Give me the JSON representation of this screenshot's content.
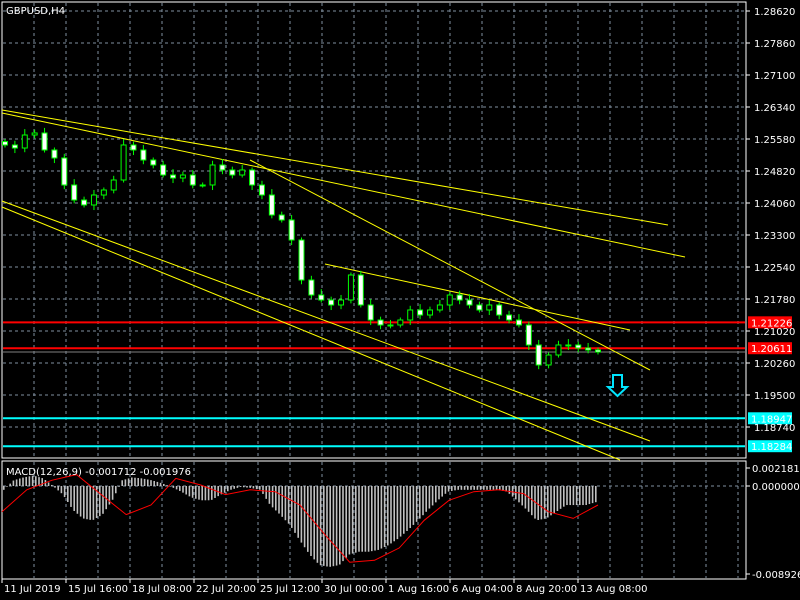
{
  "chart_data": [
    {
      "type": "candlestick",
      "title": "GBPUSD,H4",
      "grid": true,
      "ylim": [
        1.1771,
        1.29
      ],
      "y_ticks": [
        "1.28620",
        "1.27860",
        "1.27100",
        "1.26340",
        "1.25580",
        "1.24820",
        "1.24060",
        "1.23300",
        "1.22540",
        "1.21780",
        "1.21020",
        "1.20260",
        "1.19500",
        "1.18740"
      ],
      "x_ticks": [
        "11 Jul 2019",
        "15 Jul 16:00",
        "18 Jul 08:00",
        "22 Jul 20:00",
        "25 Jul 12:00",
        "30 Jul 00:00",
        "1 Aug 16:00",
        "6 Aug 04:00",
        "8 Aug 20:00",
        "13 Aug 08:00"
      ],
      "closes": [
        1.25438,
        1.25366,
        1.25675,
        1.25723,
        1.25319,
        1.25129,
        1.24488,
        1.24131,
        1.24013,
        1.2425,
        1.24369,
        1.24606,
        1.25438,
        1.25319,
        1.25081,
        1.24963,
        1.24725,
        1.24654,
        1.24725,
        1.24488,
        1.24488,
        1.24963,
        1.24844,
        1.24725,
        1.24844,
        1.24488,
        1.2425,
        1.23775,
        1.23656,
        1.23181,
        1.22231,
        1.21875,
        1.21756,
        1.21638,
        1.21756,
        1.2235,
        1.21638,
        1.21281,
        1.21163,
        1.21163,
        1.21281,
        1.21519,
        1.214,
        1.21519,
        1.21638,
        1.21875,
        1.21756,
        1.21638,
        1.21519,
        1.21638,
        1.214,
        1.21281,
        1.21163,
        1.20688,
        1.20213,
        1.2045,
        1.20688,
        1.20688,
        1.20616,
        1.20569,
        1.20521
      ],
      "horizontal_levels": [
        {
          "price": "1.21226",
          "color": "#ff0000"
        },
        {
          "price": "1.20611",
          "color": "#ff0000"
        },
        {
          "price": "1.18947",
          "color": "#00ffff"
        },
        {
          "price": "1.18284",
          "color": "#00ffff"
        }
      ],
      "trendline_color": "#ffff00",
      "arrow": {
        "icon": "down-arrow-icon",
        "color": "#00e5ff"
      },
      "colors": {
        "candle_wick": "#00ff00",
        "bear_body": "#ffffff",
        "bull_body": "#000000",
        "grid": "#8090a0"
      }
    },
    {
      "type": "bar+line",
      "title": "MACD(12,26,9) -0.001712 -0.001976",
      "y_ticks": [
        "0.002181",
        "0.000000",
        "-0.008926"
      ],
      "ylim": [
        -0.008926,
        0.002181
      ],
      "histogram": [
        -0.0004,
        0.0006,
        0.0009,
        0.0011,
        0.0008,
        0,
        -0.0009,
        -0.0025,
        -0.0034,
        -0.0036,
        -0.003,
        -0.0015,
        0.0006,
        0.0009,
        0.0008,
        0.0006,
        0.0003,
        -0.0001,
        -0.0006,
        -0.0012,
        -0.0015,
        -0.0015,
        -0.0009,
        -0.0004,
        -0.0001,
        -0.0002,
        -0.0004,
        -0.002,
        -0.003,
        -0.0041,
        -0.0057,
        -0.0072,
        -0.0083,
        -0.0085,
        -0.0083,
        -0.0072,
        -0.0069,
        -0.0069,
        -0.0067,
        -0.0062,
        -0.0055,
        -0.0046,
        -0.0036,
        -0.0025,
        -0.0015,
        -0.0006,
        -0.0004,
        -0.0004,
        -0.0004,
        -0.0004,
        -0.0004,
        -0.0006,
        -0.0015,
        -0.0025,
        -0.0036,
        -0.0034,
        -0.0027,
        -0.002,
        -0.002,
        -0.002,
        -0.0017
      ],
      "signal": [
        -0.0027,
        -0.0004,
        0.0006,
        0.0012,
        -0.0009,
        -0.003,
        -0.002,
        0.0008,
        0.0001,
        -0.0009,
        -0.0004,
        -0.0006,
        -0.002,
        -0.0051,
        -0.008,
        -0.0078,
        -0.0065,
        -0.0036,
        -0.0015,
        -0.0006,
        -0.0004,
        -0.0008,
        -0.0027,
        -0.0034,
        -0.002
      ],
      "colors": {
        "histogram": "#c0c0c0",
        "signal": "#ff0000"
      }
    }
  ]
}
